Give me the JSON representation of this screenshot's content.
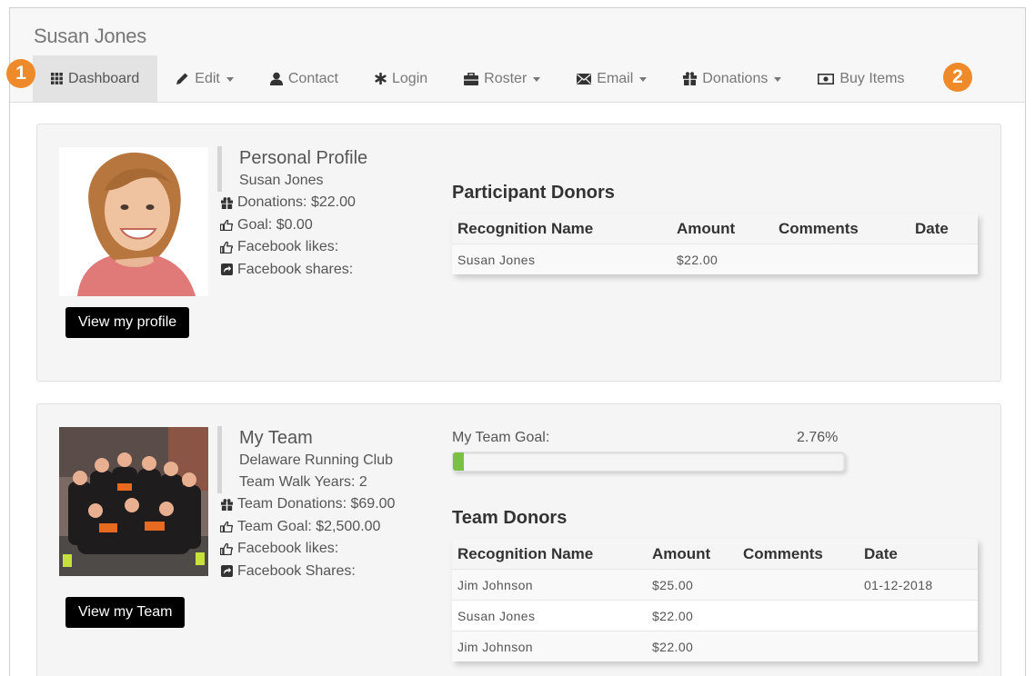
{
  "header": {
    "title": "Susan Jones"
  },
  "nav": {
    "items": [
      {
        "label": "Dashboard",
        "icon": "grid-icon",
        "has_dropdown": false,
        "active": true
      },
      {
        "label": "Edit",
        "icon": "pencil-icon",
        "has_dropdown": true,
        "active": false
      },
      {
        "label": "Contact",
        "icon": "user-icon",
        "has_dropdown": false,
        "active": false
      },
      {
        "label": "Login",
        "icon": "asterisk-icon",
        "has_dropdown": false,
        "active": false
      },
      {
        "label": "Roster",
        "icon": "briefcase-icon",
        "has_dropdown": true,
        "active": false
      },
      {
        "label": "Email",
        "icon": "envelope-icon",
        "has_dropdown": true,
        "active": false
      },
      {
        "label": "Donations",
        "icon": "gift-icon",
        "has_dropdown": true,
        "active": false
      },
      {
        "label": "Buy Items",
        "icon": "money-icon",
        "has_dropdown": false,
        "active": false
      }
    ]
  },
  "markers": [
    "1",
    "2"
  ],
  "profile": {
    "title": "Personal Profile",
    "name": "Susan Jones",
    "donations": "Donations: $22.00",
    "goal": "Goal: $0.00",
    "facebook_likes": "Facebook likes:",
    "facebook_shares": "Facebook shares:",
    "button": "View my profile",
    "donors_title": "Participant Donors",
    "columns": [
      "Recognition Name",
      "Amount",
      "Comments",
      "Date"
    ],
    "rows": [
      [
        "Susan Jones",
        "$22.00",
        "",
        ""
      ]
    ]
  },
  "team": {
    "title": "My Team",
    "name": "Delaware Running Club",
    "walk_years": "Team Walk Years: 2",
    "donations": "Team Donations: $69.00",
    "goal": "Team Goal: $2,500.00",
    "facebook_likes": "Facebook likes:",
    "facebook_shares": "Facebook Shares:",
    "button": "View my Team",
    "goal_label": "My Team Goal:",
    "goal_percent": "2.76%",
    "goal_progress": 0.0276,
    "donors_title": "Team Donors",
    "columns": [
      "Recognition Name",
      "Amount",
      "Comments",
      "Date"
    ],
    "rows": [
      [
        "Jim Johnson",
        "$25.00",
        "",
        "01-12-2018"
      ],
      [
        "Susan Jones",
        "$22.00",
        "",
        ""
      ],
      [
        "Jim Johnson",
        "$22.00",
        "",
        ""
      ]
    ]
  },
  "colors": {
    "accent_marker": "#ef8a2a",
    "progress": "#7cc043"
  }
}
